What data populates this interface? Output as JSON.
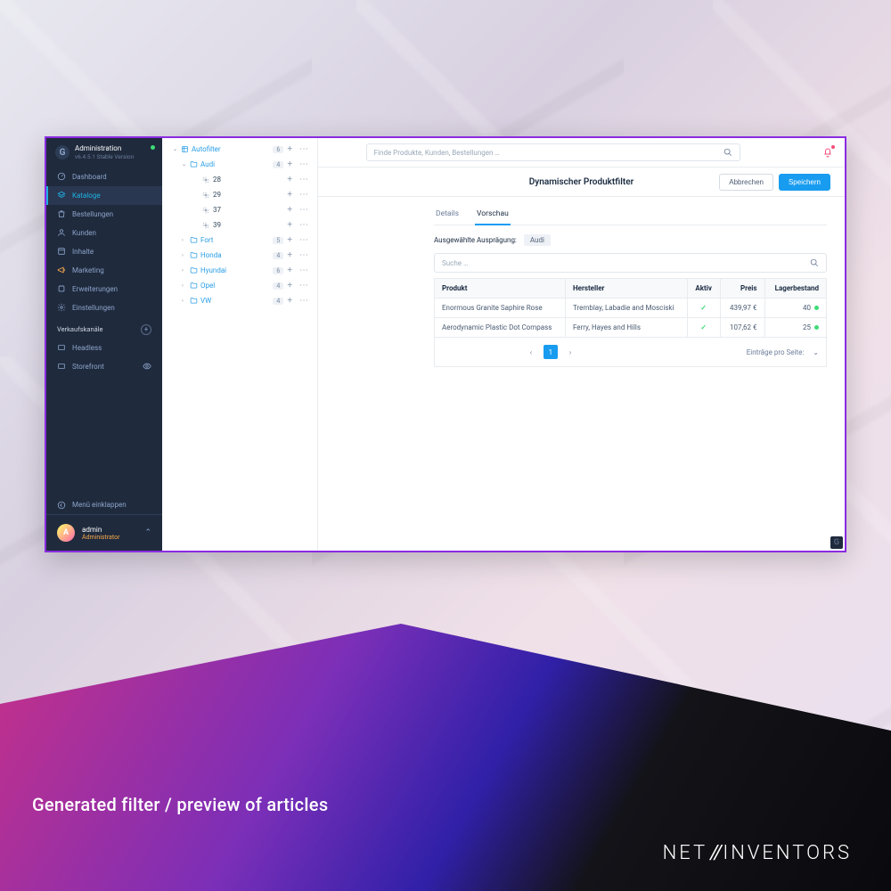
{
  "caption": "Generated filter / preview of articles",
  "footer_brand_1": "NET",
  "footer_brand_2": "INVENTORS",
  "sidebar": {
    "title": "Administration",
    "subtitle": "v6.4.5.1 Stable Version",
    "items": [
      {
        "label": "Dashboard"
      },
      {
        "label": "Kataloge"
      },
      {
        "label": "Bestellungen"
      },
      {
        "label": "Kunden"
      },
      {
        "label": "Inhalte"
      },
      {
        "label": "Marketing"
      },
      {
        "label": "Erweiterungen"
      },
      {
        "label": "Einstellungen"
      }
    ],
    "channels_header": "Verkaufskanäle",
    "channels": [
      {
        "label": "Headless"
      },
      {
        "label": "Storefront"
      }
    ],
    "collapse": "Menü einklappen",
    "user": {
      "name": "admin",
      "role": "Administrator",
      "initial": "A"
    }
  },
  "search_placeholder": "Finde Produkte, Kunden, Bestellungen …",
  "page_title": "Dynamischer Produktfilter",
  "buttons": {
    "cancel": "Abbrechen",
    "save": "Speichern"
  },
  "tree": [
    {
      "label": "Autofilter",
      "count": "6",
      "type": "root",
      "indent": 1,
      "open": true
    },
    {
      "label": "Audi",
      "count": "4",
      "type": "folder",
      "indent": 2,
      "open": true
    },
    {
      "label": "28",
      "type": "leaf",
      "indent": 3
    },
    {
      "label": "29",
      "type": "leaf",
      "indent": 3
    },
    {
      "label": "37",
      "type": "leaf",
      "indent": 3
    },
    {
      "label": "39",
      "type": "leaf",
      "indent": 3
    },
    {
      "label": "Fort",
      "count": "5",
      "type": "folder",
      "indent": 2
    },
    {
      "label": "Honda",
      "count": "4",
      "type": "folder",
      "indent": 2
    },
    {
      "label": "Hyundai",
      "count": "6",
      "type": "folder",
      "indent": 2
    },
    {
      "label": "Opel",
      "count": "4",
      "type": "folder",
      "indent": 2
    },
    {
      "label": "VW",
      "count": "4",
      "type": "folder",
      "indent": 2
    }
  ],
  "tabs": {
    "details": "Details",
    "preview": "Vorschau"
  },
  "selected_label": "Ausgewählte Ausprägung:",
  "selected_value": "Audi",
  "table_search_placeholder": "Suche …",
  "columns": {
    "product": "Produkt",
    "manufacturer": "Hersteller",
    "active": "Aktiv",
    "price": "Preis",
    "stock": "Lagerbestand"
  },
  "rows": [
    {
      "product": "Enormous Granite Saphire Rose",
      "manufacturer": "Tremblay, Labadie and Mosciski",
      "active": true,
      "price": "439,97 €",
      "stock": "40"
    },
    {
      "product": "Aerodynamic Plastic Dot Compass",
      "manufacturer": "Ferry, Hayes and Hills",
      "active": true,
      "price": "107,62 €",
      "stock": "25"
    }
  ],
  "pager": {
    "current": "1",
    "per_page_label": "Einträge pro Seite:"
  }
}
